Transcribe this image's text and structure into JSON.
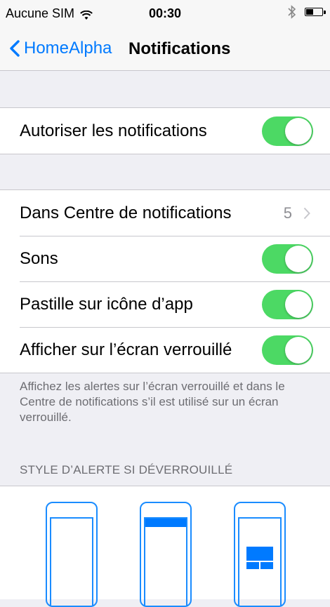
{
  "status_bar": {
    "carrier": "Aucune SIM",
    "time": "00:30"
  },
  "nav": {
    "back_label": "HomeAlpha",
    "title": "Notifications"
  },
  "group1": {
    "allow_label": "Autoriser les notifications",
    "allow_on": true
  },
  "group2": {
    "items": [
      {
        "label": "Dans Centre de notifications",
        "value": "5"
      },
      {
        "label": "Sons",
        "on": true
      },
      {
        "label": "Pastille sur icône d’app",
        "on": true
      },
      {
        "label": "Afficher sur l’écran verrouillé",
        "on": true
      }
    ]
  },
  "footer": {
    "text": "Affichez les alertes sur l’écran verrouillé et dans le Centre de notifications s’il est utilisé sur un écran verrouillé."
  },
  "alert_style": {
    "header": "STYLE D’ALERTE SI DÉVERROUILLÉ",
    "options": [
      "none-icon",
      "banner-icon",
      "alert-icon"
    ]
  },
  "colors": {
    "accent": "#007aff",
    "toggle_on": "#4cd964",
    "background": "#efeff4"
  }
}
